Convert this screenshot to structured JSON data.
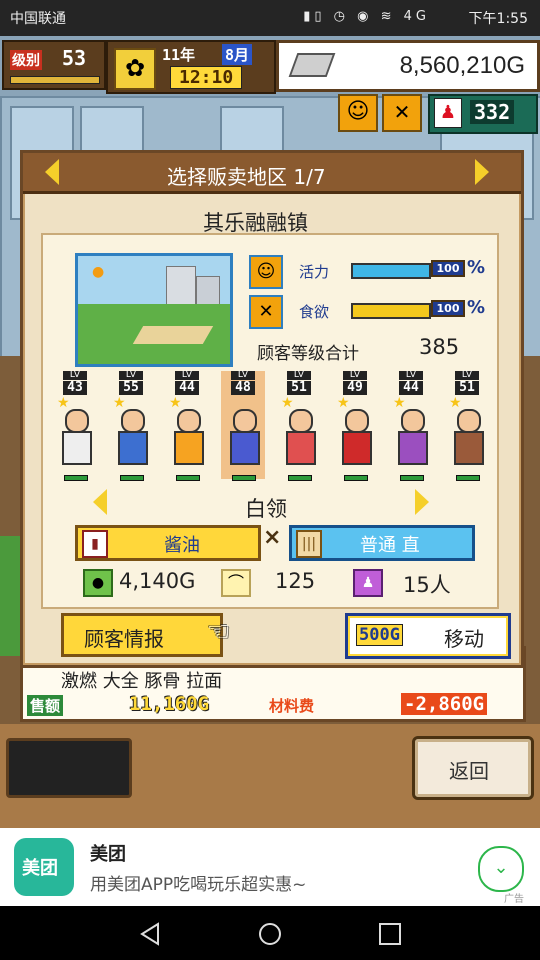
{
  "statusbar": {
    "carrier": "中国联通",
    "signal": "4G",
    "time": "下午1:55"
  },
  "hud": {
    "rank_label": "级别",
    "rank_value": "53",
    "date_year": "11年",
    "date_month": "8月",
    "clock": "12:10",
    "money": "8,560,210G",
    "people_count": "332"
  },
  "dialog": {
    "title": "选择贩卖地区 1/7",
    "town": "其乐融融镇",
    "stats": [
      {
        "label": "活力",
        "value": "100",
        "color": "#3fb6e6"
      },
      {
        "label": "食欲",
        "value": "100",
        "color": "#f3c81d"
      }
    ],
    "customer_rank_label": "顾客等级合计",
    "customer_rank_value": "385",
    "characters": [
      {
        "lv": "43",
        "shirt": "#eeeeee",
        "selected": false
      },
      {
        "lv": "55",
        "shirt": "#3d6fd0",
        "selected": false
      },
      {
        "lv": "44",
        "shirt": "#f6a321",
        "selected": false
      },
      {
        "lv": "48",
        "shirt": "#4a5ad0",
        "selected": true
      },
      {
        "lv": "51",
        "shirt": "#e05050",
        "selected": false
      },
      {
        "lv": "49",
        "shirt": "#cf2a2a",
        "selected": false
      },
      {
        "lv": "44",
        "shirt": "#9b4fbf",
        "selected": false
      },
      {
        "lv": "51",
        "shirt": "#9a5a3a",
        "selected": false
      }
    ],
    "lv_tag": "LV",
    "category": "白领",
    "ingredient": "酱油",
    "times": "×",
    "cut": "普通 直",
    "price": "4,140G",
    "quantity": "125",
    "customers": "15人",
    "info_button": "顾客情报",
    "move_cost": "500G",
    "move_label": "移动"
  },
  "behind": {
    "dish": "激燃 大全 豚骨 拉面",
    "sales_label": "售额",
    "sales_value": "11,160G",
    "cost_label": "材料费",
    "cost_value": "-2,860G"
  },
  "back_button": "返回",
  "ad": {
    "app_name": "美团",
    "icon_text": "美团",
    "description": "用美团APP吃喝玩乐超实惠~",
    "tag": "广告"
  }
}
